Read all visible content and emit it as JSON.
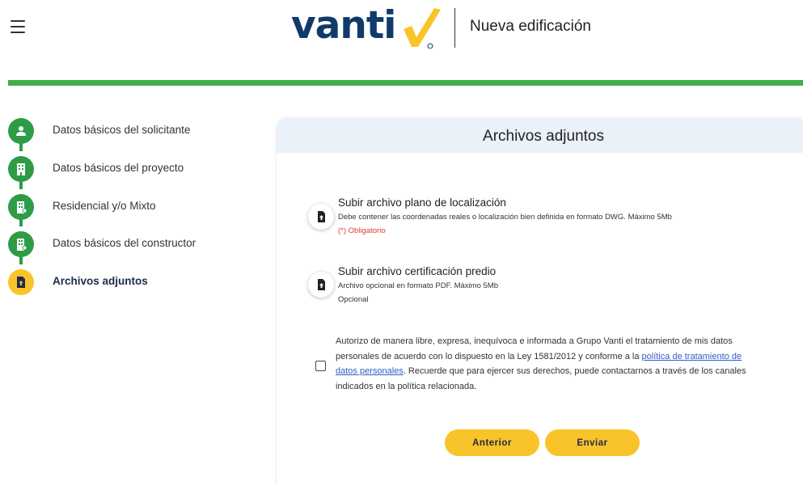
{
  "header": {
    "menu_icon": "hamburger-icon",
    "logo_text": "vanti",
    "logo_mark_icon": "checkmark-logo-icon",
    "title": "Nueva edificación"
  },
  "colors": {
    "brand_green": "#3FAE49",
    "step_done": "#2E9C47",
    "step_active": "#F9C32A",
    "logo_blue": "#113A6B",
    "logo_yellow": "#F9C32A",
    "required_red": "#E53935",
    "link_blue": "#2F5EC4",
    "button_yellow": "#F9C32A"
  },
  "steps": [
    {
      "label": "Datos básicos del solicitante",
      "icon": "person-icon",
      "status": "done"
    },
    {
      "label": "Datos básicos del proyecto",
      "icon": "building-icon",
      "status": "done"
    },
    {
      "label": "Residencial y/o Mixto",
      "icon": "building-icon",
      "status": "done"
    },
    {
      "label": "Datos básicos del constructor",
      "icon": "building-icon",
      "status": "done"
    },
    {
      "label": "Archivos adjuntos",
      "icon": "upload-file-icon",
      "status": "active"
    }
  ],
  "main": {
    "title": "Archivos adjuntos",
    "uploads": [
      {
        "title": "Subir archivo plano de localización",
        "description": "Debe contener las coordenadas reales o localización bien definida en formato DWG. Máximo 5Mb",
        "requirement": "(*) Obligatorio",
        "icon": "upload-file-icon"
      },
      {
        "title": "Subir archivo certificación predio",
        "description": "Archivo opcional en formato PDF. Máximo 5Mb",
        "requirement": "Opcional",
        "icon": "upload-file-icon"
      }
    ],
    "consent": {
      "text_before": "Autorizo de manera libre, expresa, inequívoca e informada a Grupo Vanti el tratamiento de mis datos personales de acuerdo con lo dispuesto en la Ley 1581/2012 y conforme a la ",
      "link": "política de tratamiento de datos personales",
      "text_after": ". Recuerde que para ejercer sus derechos, puede contactarnos a través de los canales indicados en la política relacionada.",
      "checked": false
    },
    "buttons": {
      "previous": "Anterior",
      "submit": "Enviar"
    }
  }
}
